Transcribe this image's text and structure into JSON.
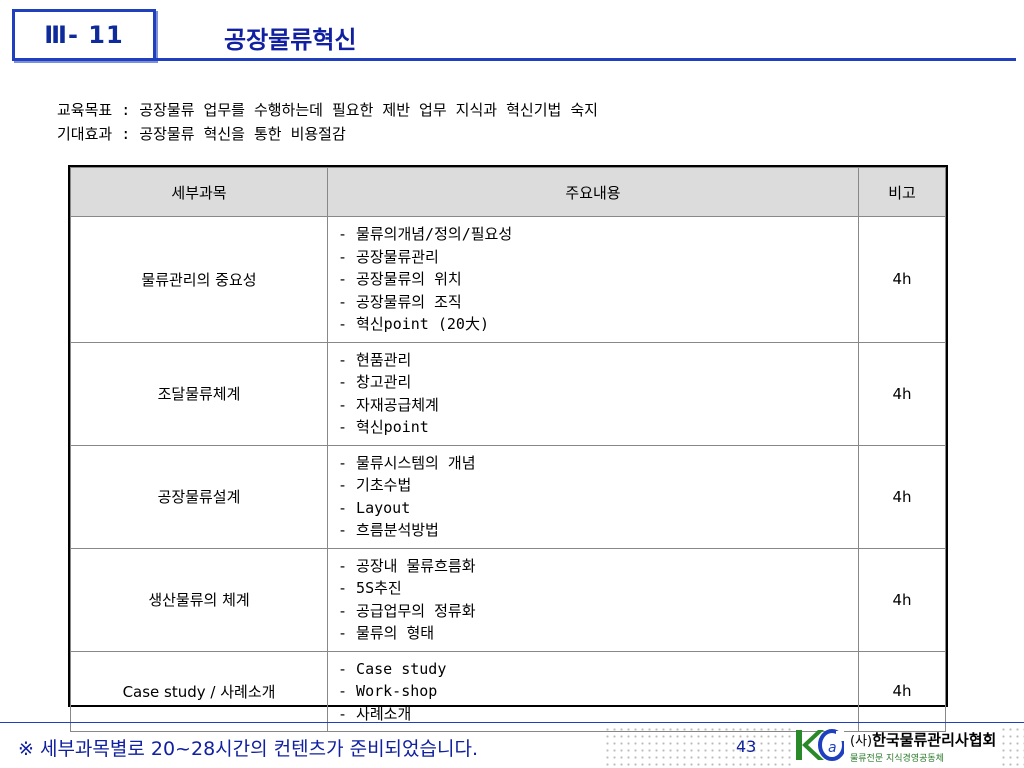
{
  "header": {
    "section_number": "Ⅲ- 11",
    "title": "공장물류혁신"
  },
  "objectives": {
    "goal": "교육목표 : 공장물류 업무를 수행하는데 필요한 제반 업무 지식과 혁신기법 숙지",
    "effect": "기대효과 : 공장물류 혁신을 통한 비용절감"
  },
  "table": {
    "headers": [
      "세부과목",
      "주요내용",
      "비고"
    ],
    "rows": [
      {
        "subject": "물류관리의 중요성",
        "content": [
          "- 물류의개념/정의/필요성",
          "- 공장물류관리",
          "- 공장물류의 위치",
          "- 공장물류의 조직",
          "- 혁신point (20大)"
        ],
        "note": "4h"
      },
      {
        "subject": "조달물류체계",
        "content": [
          "- 현품관리",
          "- 창고관리",
          "- 자재공급체계",
          "- 혁신point"
        ],
        "note": "4h"
      },
      {
        "subject": "공장물류설계",
        "content": [
          "- 물류시스템의 개념",
          "- 기초수법",
          "- Layout",
          "- 흐름분석방법"
        ],
        "note": "4h"
      },
      {
        "subject": "생산물류의 체계",
        "content": [
          "- 공장내 물류흐름화",
          "- 5S추진",
          "- 공급업무의 정류화",
          "- 물류의 형태"
        ],
        "note": "4h"
      },
      {
        "subject": "Case study / 사례소개",
        "content": [
          "- Case study",
          "- Work-shop",
          "- 사례소개"
        ],
        "note": "4h"
      }
    ]
  },
  "footer": {
    "note": "※ 세부과목별로 20~28시간의 컨텐츠가 준비되었습니다.",
    "page_number": "43",
    "org_prefix": "(사)",
    "org_name": "한국물류관리사협회",
    "org_tagline": "물류전문  지식경영공동체",
    "logo_text": "KLA"
  },
  "colors": {
    "accent_blue": "#1f3fbf",
    "title_blue": "#1020a0",
    "header_gray": "#dcdcdc",
    "logo_green": "#2a8a2a"
  }
}
